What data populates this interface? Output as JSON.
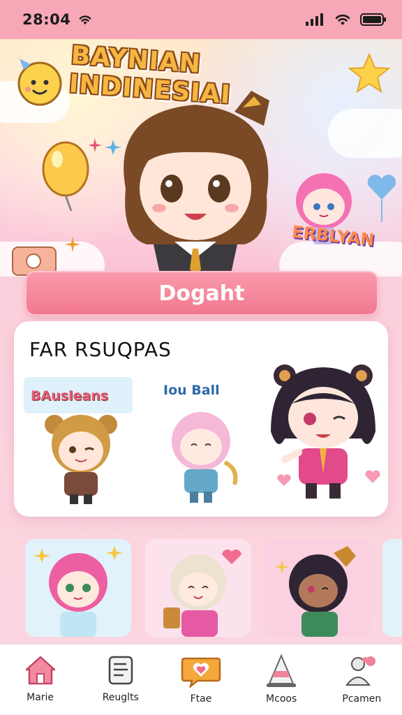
{
  "status_bar": {
    "time": "28:04",
    "icons": [
      "wifi-icon",
      "signal-icon",
      "wifi-icon",
      "battery-icon"
    ]
  },
  "hero": {
    "title": "BAYNIAN INDINESIAI",
    "badge": "ERBLYAN"
  },
  "cta": {
    "label": "Dogaht"
  },
  "featured": {
    "title": "FAR RSUQPAS",
    "stickers": [
      {
        "label": "BAusleans"
      },
      {
        "label": "Iou Ball"
      }
    ]
  },
  "bottom_nav": [
    {
      "label": "Marie",
      "icon": "home-icon",
      "color": "#e35b79"
    },
    {
      "label": "Reuglts",
      "icon": "document-icon",
      "color": "#555555"
    },
    {
      "label": "Ftae",
      "icon": "chat-heart-icon",
      "color": "#f29a2e"
    },
    {
      "label": "Mcoos",
      "icon": "cone-icon",
      "color": "#e3778e"
    },
    {
      "label": "Pcamen",
      "icon": "profile-icon",
      "color": "#777777"
    }
  ],
  "colors": {
    "accent": "#f2788f",
    "status_bar": "#f7a7b6",
    "background": "#fbd0dc"
  }
}
